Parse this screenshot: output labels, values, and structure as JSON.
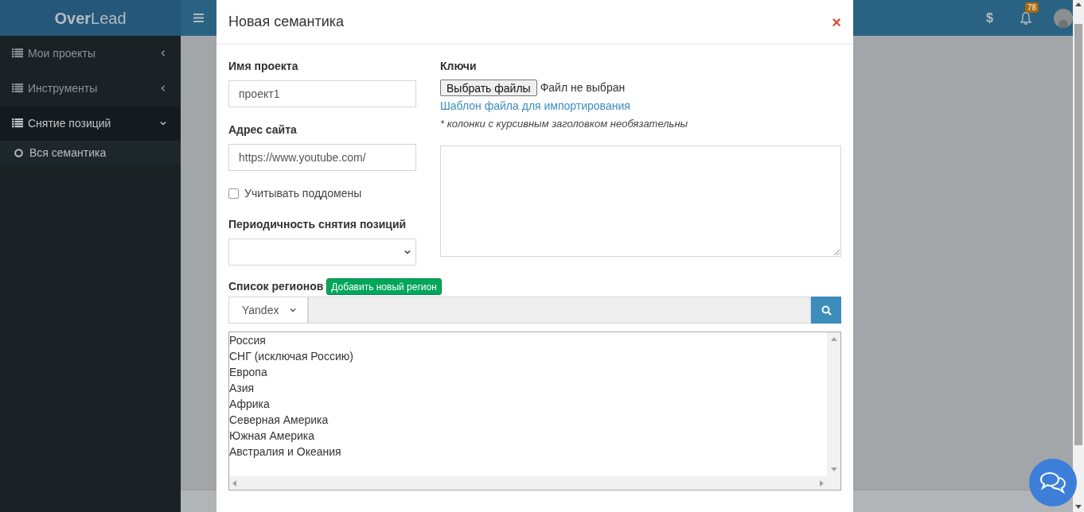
{
  "app": {
    "logo": "**Over**Lead"
  },
  "header": {
    "currency_symbol": "$",
    "notifications_count": "78"
  },
  "sidebar": {
    "items": [
      {
        "label": "Мои проекты",
        "expanded": false
      },
      {
        "label": "Инструменты",
        "expanded": false
      },
      {
        "label": "Снятие позиций",
        "expanded": true,
        "children": [
          {
            "label": "Вся семантика"
          }
        ]
      }
    ]
  },
  "modal": {
    "title": "Новая семантика",
    "close": "×",
    "project_name": {
      "label": "Имя проекта",
      "value": "проект1"
    },
    "site_address": {
      "label": "Адрес сайта",
      "value": "https://www.youtube.com/"
    },
    "subdomains": {
      "label": "Учитывать поддомены",
      "checked": false
    },
    "frequency": {
      "label": "Периодичность снятия позиций"
    },
    "keys": {
      "label": "Ключи",
      "file_button": "Выбрать файлы",
      "file_status": "Файл не выбран",
      "template_link": "Шаблон файла для импортирования",
      "note": "* колонки с курсивным заголовком необязательны"
    },
    "regions": {
      "label": "Список регионов",
      "add_button": "Добавить новый регион",
      "engine": "Yandex",
      "items": [
        {
          "label": "Россия"
        },
        {
          "label": "СНГ (исключая Россию)"
        },
        {
          "label": "Европа"
        },
        {
          "label": "Азия"
        },
        {
          "label": "Африка"
        },
        {
          "label": "Северная Америка"
        },
        {
          "label": "Южная Америка"
        },
        {
          "label": "Австралия и Океания"
        }
      ]
    }
  }
}
